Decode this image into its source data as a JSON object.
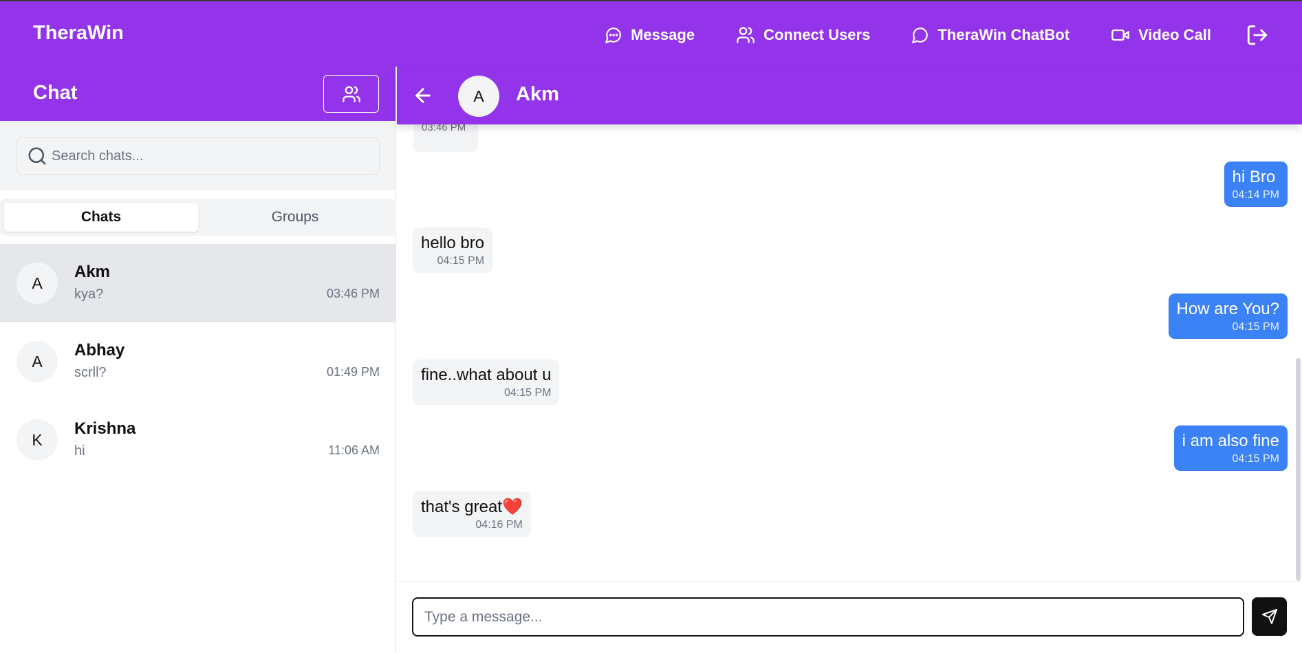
{
  "brand": "TheraWin",
  "nav": {
    "message": "Message",
    "connect_users": "Connect Users",
    "chatbot": "TheraWin ChatBot",
    "video_call": "Video Call"
  },
  "sidebar": {
    "title": "Chat",
    "search_placeholder": "Search chats...",
    "tabs": [
      {
        "label": "Chats",
        "active": true
      },
      {
        "label": "Groups",
        "active": false
      }
    ],
    "chats": [
      {
        "initial": "A",
        "name": "Akm",
        "last_message": "kya?",
        "time": "03:46 PM",
        "active": true
      },
      {
        "initial": "A",
        "name": "Abhay",
        "last_message": "scrll?",
        "time": "01:49 PM",
        "active": false
      },
      {
        "initial": "K",
        "name": "Krishna",
        "last_message": "hi",
        "time": "11:06 AM",
        "active": false
      }
    ]
  },
  "conversation": {
    "contact_initial": "A",
    "contact_name": "Akm",
    "messages": [
      {
        "direction": "sent",
        "text": "hi Bro",
        "time": "04:14 PM"
      },
      {
        "direction": "received",
        "text": "hello bro",
        "time": "04:15 PM"
      },
      {
        "direction": "sent",
        "text": "How are You?",
        "time": "04:15 PM"
      },
      {
        "direction": "received",
        "text": "fine..what about u",
        "time": "04:15 PM"
      },
      {
        "direction": "sent",
        "text": "i am also fine",
        "time": "04:15 PM"
      },
      {
        "direction": "received",
        "text": "that's great❤️",
        "time": "04:16 PM"
      }
    ],
    "composer_placeholder": "Type a message..."
  },
  "colors": {
    "brand_purple": "#9333ea",
    "sent_bubble": "#3b82f6",
    "received_bubble": "#f3f4f6"
  }
}
